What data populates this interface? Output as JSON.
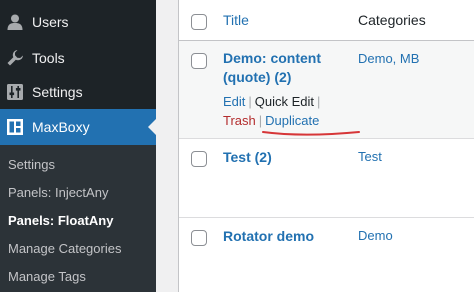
{
  "sidebar": {
    "menu": [
      {
        "label": "Users",
        "icon": "user-icon"
      },
      {
        "label": "Tools",
        "icon": "wrench-icon"
      },
      {
        "label": "Settings",
        "icon": "settings-sliders-icon"
      },
      {
        "label": "MaxBoxy",
        "icon": "maxboxy-icon",
        "active": true
      }
    ],
    "submenu": [
      {
        "label": "Settings"
      },
      {
        "label": "Panels: InjectAny"
      },
      {
        "label": "Panels: FloatAny",
        "current": true
      },
      {
        "label": "Manage Categories"
      },
      {
        "label": "Manage Tags"
      }
    ]
  },
  "table": {
    "headers": {
      "title": "Title",
      "categories": "Categories"
    },
    "rows": [
      {
        "title_line1": "Demo: content",
        "title_line2": "(quote) (2)",
        "categories": "Demo, MB",
        "actions": {
          "edit": "Edit",
          "quick_edit": "Quick Edit",
          "trash": "Trash",
          "duplicate": "Duplicate",
          "separator": "|"
        }
      },
      {
        "title": "Test (2)",
        "categories": "Test"
      },
      {
        "title": "Rotator demo",
        "categories": "Demo"
      }
    ]
  },
  "colors": {
    "sidebar_bg": "#1d2327",
    "submenu_bg": "#2c3338",
    "accent": "#2271b1",
    "trash": "#b32d2e",
    "annotation": "#d63638"
  }
}
